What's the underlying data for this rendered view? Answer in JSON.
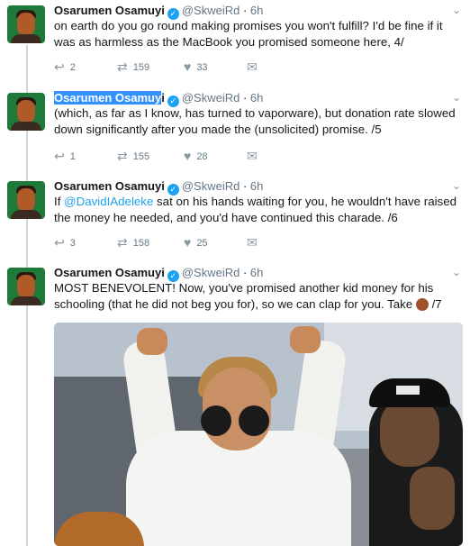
{
  "thread": {
    "tweets": [
      {
        "name": "Osarumen Osamuyi",
        "handle": "@SkweiRd",
        "time": "6h",
        "text": "on earth do you go round making promises you won't fulfill? I'd be fine if it was as harmless as the MacBook you promised someone here, 4/",
        "replies": "2",
        "retweets": "159",
        "likes": "33"
      },
      {
        "name_selected": "Osarumen Osamuy",
        "name_rest": "i",
        "handle": "@SkweiRd",
        "time": "6h",
        "text": "(which, as far as I know, has turned to vaporware), but donation rate slowed down significantly after you made the (unsolicited) promise. /5",
        "replies": "1",
        "retweets": "155",
        "likes": "28"
      },
      {
        "name": "Osarumen Osamuyi",
        "handle": "@SkweiRd",
        "time": "6h",
        "text_before": "If ",
        "mention": "@DavidIAdeleke",
        "text_after": " sat on his hands waiting for you, he wouldn't have raised the money he needed, and you'd have continued this charade. /6",
        "replies": "3",
        "retweets": "158",
        "likes": "25"
      },
      {
        "name": "Osarumen Osamuyi",
        "handle": "@SkweiRd",
        "time": "6h",
        "text": "MOST BENEVOLENT! Now, you've promised another kid money for his schooling (that he did not beg you for), so we can clap for you. Take",
        "text_end": "/7"
      }
    ]
  },
  "icons": {
    "verified": "✓",
    "chevron": "⌄",
    "reply": "↩",
    "retweet": "⇄",
    "like": "♥",
    "dm": "✉"
  },
  "colors": {
    "link": "#1da1f2",
    "selection": "#3390ff",
    "muted": "#657786"
  }
}
